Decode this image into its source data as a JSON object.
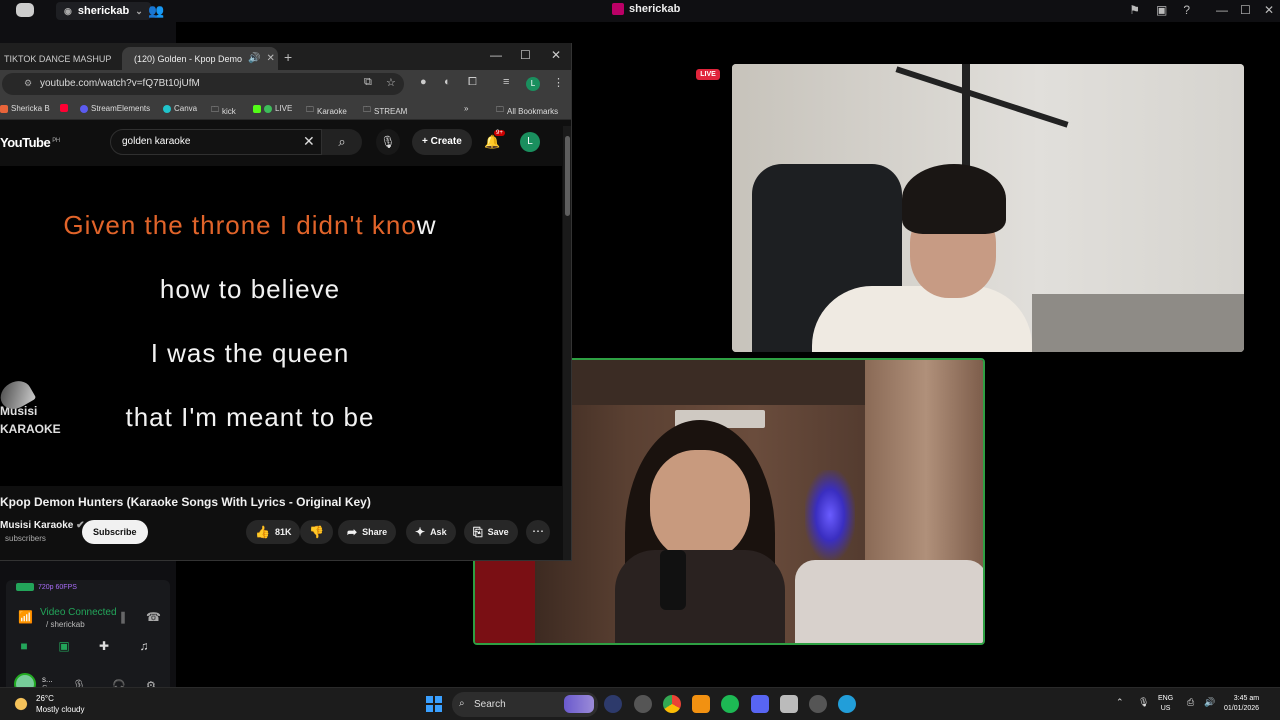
{
  "discord": {
    "server_name": "sherickab",
    "call_title": "sherickab",
    "live_label": "LIVE",
    "stream_quality": "720p 60FPS",
    "voice_status": "Video Connected",
    "voice_channel": "/ sherickab",
    "user_name": "s...",
    "user_status": "S..."
  },
  "chrome": {
    "tabs": [
      {
        "label": "TIKTOK DANCE MASHUP"
      },
      {
        "label": "(120) Golden - Kpop Demo"
      }
    ],
    "url": "youtube.com/watch?v=fQ7Bt10jUfM",
    "bookmarks": [
      {
        "label": "Shericka B",
        "color": "#e8643a"
      },
      {
        "label": "",
        "color": "#ff0033"
      },
      {
        "label": "StreamElements",
        "color": "#5b5bf0"
      },
      {
        "label": "Canva",
        "color": "#20c4cb"
      },
      {
        "label": "kick",
        "color": "#bbbbbb"
      },
      {
        "label": "LIVE",
        "color": "#53fc18"
      },
      {
        "label": "Karaoke",
        "color": "#bbbbbb"
      },
      {
        "label": "STREAM",
        "color": "#bbbbbb"
      }
    ],
    "bookmarks_more": "»",
    "all_bookmarks": "All Bookmarks",
    "profile_initial": "L"
  },
  "youtube": {
    "logo": "YouTube",
    "region": "PH",
    "search_value": "golden karaoke",
    "create_label": "Create",
    "notif_count": "9+",
    "avatar_initial": "L",
    "lyrics": [
      {
        "sung": "Given the throne I didn't kno",
        "unsung": "w"
      },
      {
        "sung": "",
        "unsung": "how to believe"
      },
      {
        "sung": "",
        "unsung": "I was the queen"
      },
      {
        "sung": "",
        "unsung": "that I'm meant to be"
      }
    ],
    "watermark_line1": "Musisi",
    "watermark_line2": "KARAOKE",
    "video_title": "Kpop Demon Hunters (Karaoke Songs With Lyrics - Original Key)",
    "channel_name": "Musisi Karaoke",
    "subscribers": "subscribers",
    "subscribe_label": "Subscribe",
    "like_count": "81K",
    "share_label": "Share",
    "ask_label": "Ask",
    "save_label": "Save"
  },
  "taskbar": {
    "temperature": "26°C",
    "weather": "Mostly cloudy",
    "search_label": "Search",
    "lang_line1": "ENG",
    "lang_line2": "US",
    "time": "3:45 am",
    "date": "01/01/2026"
  }
}
